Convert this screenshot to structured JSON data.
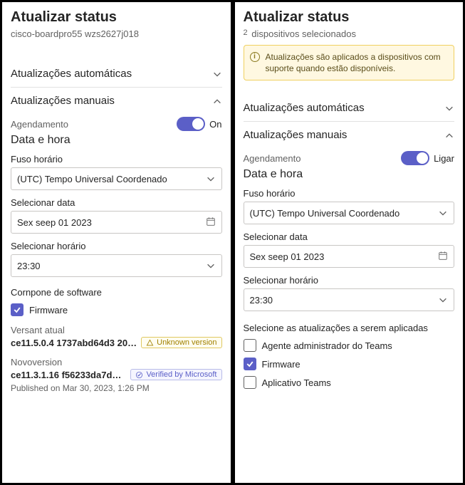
{
  "left": {
    "title": "Atualizar status",
    "device": "cisco-boardpro55 wzs2627j018",
    "sec_auto": "Atualizações automáticas",
    "sec_manual": "Atualizações manuais",
    "schedule_label": "Agendamento",
    "toggle_state": "On",
    "datetime_heading": "Data e hora",
    "tz_label": "Fuso horário",
    "tz_value": "(UTC) Tempo Universal Coordenado",
    "date_label": "Selecionar data",
    "date_value": "Sex seep 01 2023",
    "time_label": "Selecionar horário",
    "time_value": "23:30",
    "sw_component_label": "Cornpone de software",
    "firmware_label": "Firmware",
    "current_version_label": "Versant atual",
    "current_version_hash": "ce11.5.0.4 1737abd64d3 2023...",
    "unknown_version_badge": "Unknown version",
    "new_version_label": "Novoversion",
    "new_version_hash": "ce11.3.1.16 f56233da7d5 2...",
    "verified_badge": "Verified by Microsoft",
    "published_text": "Published on Mar 30, 2023, 1:26 PM"
  },
  "right": {
    "title": "Atualizar status",
    "devices_count": "2",
    "devices_selected": "dispositivos selecionados",
    "info_text": "Atualizações são aplicados a dispositivos com suporte quando estão disponíveis.",
    "sec_auto": "Atualizações automáticas",
    "sec_manual": "Atualizações manuais",
    "schedule_label": "Agendamento",
    "toggle_state": "Ligar",
    "datetime_heading": "Data e hora",
    "tz_label": "Fuso horário",
    "tz_value": "(UTC) Tempo Universal Coordenado",
    "date_label": "Selecionar data",
    "date_value": "Sex seep 01 2023",
    "time_label": "Selecionar horário",
    "time_value": "23:30",
    "select_updates_label": "Selecione as atualizações a serem aplicadas",
    "checks": {
      "teams_admin": "Agente administrador do Teams",
      "firmware": "Firmware",
      "teams_app": "Aplicativo Teams"
    }
  }
}
